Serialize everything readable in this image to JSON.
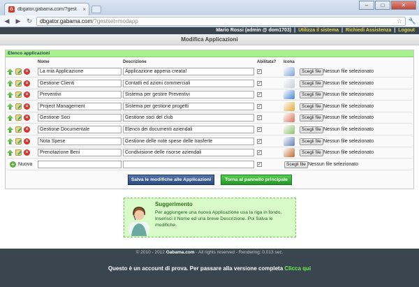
{
  "browser": {
    "tab_title": "dbgator.gabama.com/?gest",
    "url_host": "dbgator.gabama.com",
    "url_path": "/?gestsel=modapp"
  },
  "userbar": {
    "user": "Mario Rossi (admin @ dom1703)",
    "links": [
      "Utilizza il sistema",
      "Richiedi Assistenza",
      "Logout"
    ]
  },
  "page": {
    "title": "Modifica Applicazioni"
  },
  "panel": {
    "title": "Elenco applicazioni",
    "columns": {
      "name": "Nome",
      "description": "Descrizione",
      "enabled": "Abilitata?",
      "icon": "Icona"
    },
    "file_button": "Scegli file",
    "no_file": "Nessun file selezionato",
    "rows": [
      {
        "name": "La mia Applicazione",
        "description": "Applicazione appena creata!",
        "icon_color": "#7fa3d9"
      },
      {
        "name": "Gestione Clienti",
        "description": "Contatti ed azioni commerciali",
        "icon_color": "#c9ccd0"
      },
      {
        "name": "Preventivi",
        "description": "Sistema per gestire Preventivi",
        "icon_color": "#4a86d0"
      },
      {
        "name": "Project Management",
        "description": "Sistema per gestione progetti",
        "icon_color": "#e2a53a"
      },
      {
        "name": "Gestione Soci",
        "description": "Gestione soci del club",
        "icon_color": "#d9725a"
      },
      {
        "name": "Gestione Documentale",
        "description": "Elenco dei documenti aziendali",
        "icon_color": "#8bbf6a"
      },
      {
        "name": "Nota Spese",
        "description": "Gestione delle note spese delle trasferte",
        "icon_color": "#5d7fb5"
      },
      {
        "name": "Prenotazione Beni",
        "description": "Condivisione delle risorse aziendali",
        "icon_color": "#c06a2b"
      }
    ],
    "new_row_label": "Nuova"
  },
  "buttons": {
    "save": "Salva le modifiche alle Applicazioni",
    "home": "Torna al pannello principale"
  },
  "hint": {
    "title": "Suggerimento",
    "text": "Per aggiungere una nuova Applicazione usa la riga in fondo. Inserisci il Nome ed una breve Descrizione. Poi Salva le modifiche."
  },
  "footer": {
    "prefix": "© 2010 - 2012 ",
    "brand": "Gabama.com",
    "suffix": " - All rights reserved - Rendering: 0.013 sec."
  },
  "demo": {
    "text": "Questo è un account di prova. Per passare alla versione completa ",
    "link": "Clicca qui"
  }
}
